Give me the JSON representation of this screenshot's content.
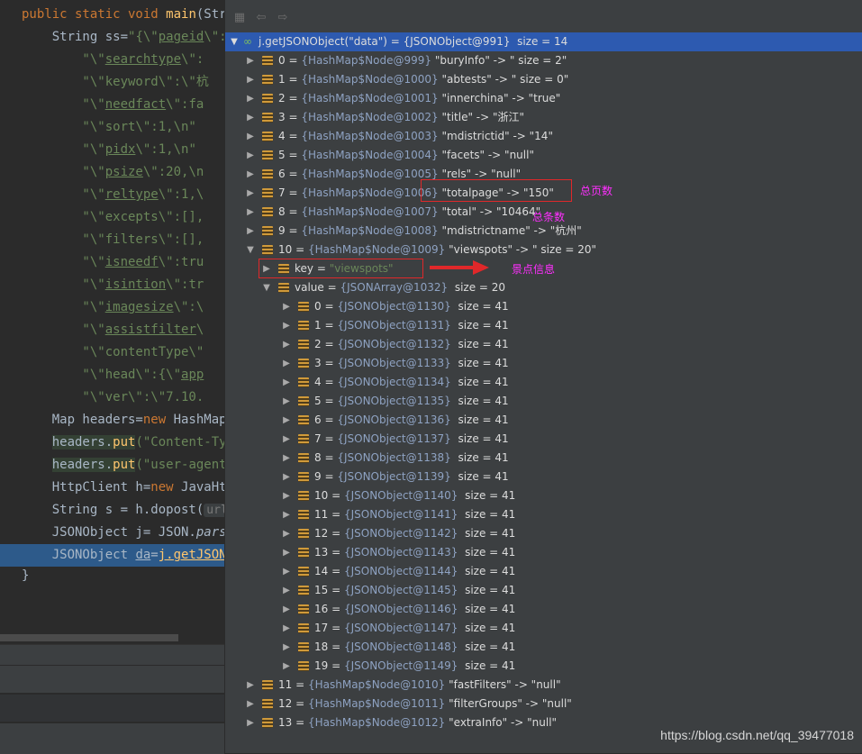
{
  "editor": {
    "lines": [
      {
        "segs": [
          [
            "kw",
            "public static void "
          ],
          [
            "fn",
            "main"
          ],
          [
            "p",
            "(Stri"
          ]
        ]
      },
      {
        "segs": [
          [
            "p",
            "    String ss="
          ],
          [
            "str",
            "\"{\\\""
          ],
          [
            "str ul",
            "pageid"
          ],
          [
            "str",
            "\\\":1"
          ]
        ]
      },
      {
        "segs": [
          [
            "str",
            "        \"\\\""
          ],
          [
            "str ul",
            "searchtype"
          ],
          [
            "str",
            "\\\":"
          ]
        ]
      },
      {
        "segs": [
          [
            "str",
            "        \"\\\"keyword\\\":\\\"杭"
          ]
        ]
      },
      {
        "segs": [
          [
            "str",
            "        \"\\\""
          ],
          [
            "str ul",
            "needfact"
          ],
          [
            "str",
            "\\\":fa"
          ]
        ]
      },
      {
        "segs": [
          [
            "str",
            "        \"\\\"sort\\\":1,\\n\""
          ]
        ]
      },
      {
        "segs": [
          [
            "str",
            "        \"\\\""
          ],
          [
            "str ul",
            "pidx"
          ],
          [
            "str",
            "\\\":1,\\n\""
          ]
        ]
      },
      {
        "segs": [
          [
            "str",
            "        \"\\\""
          ],
          [
            "str ul",
            "psize"
          ],
          [
            "str",
            "\\\":20,\\n"
          ]
        ]
      },
      {
        "segs": [
          [
            "str",
            "        \"\\\""
          ],
          [
            "str ul",
            "reltype"
          ],
          [
            "str",
            "\\\":1,\\"
          ]
        ]
      },
      {
        "segs": [
          [
            "str",
            "        \"\\\"excepts\\\":[],"
          ]
        ]
      },
      {
        "segs": [
          [
            "str",
            "        \"\\\"filters\\\":[],"
          ]
        ]
      },
      {
        "segs": [
          [
            "str",
            "        \"\\\""
          ],
          [
            "str ul",
            "isneedf"
          ],
          [
            "str",
            "\\\":tru"
          ]
        ]
      },
      {
        "segs": [
          [
            "str",
            "        \"\\\""
          ],
          [
            "str ul",
            "isintion"
          ],
          [
            "str",
            "\\\":tr"
          ]
        ]
      },
      {
        "segs": [
          [
            "str",
            "        \"\\\""
          ],
          [
            "str ul",
            "imagesize"
          ],
          [
            "str",
            "\\\":\\"
          ]
        ]
      },
      {
        "segs": [
          [
            "str",
            "        \"\\\""
          ],
          [
            "str ul",
            "assistfilter"
          ],
          [
            "str",
            "\\"
          ]
        ]
      },
      {
        "segs": [
          [
            "str",
            "        \"\\\"contentType\\\""
          ]
        ]
      },
      {
        "segs": [
          [
            "str",
            "        \"\\\"head\\\":{\\\""
          ],
          [
            "str ul",
            "app"
          ]
        ]
      },
      {
        "segs": [
          [
            "str",
            "        \"\\\"ver\\\":\\\"7.10."
          ]
        ]
      },
      {
        "segs": [
          [
            "p",
            "    Map headers="
          ],
          [
            "kw",
            "new "
          ],
          [
            "p",
            "HashMap("
          ]
        ]
      },
      {
        "segs": [
          [
            "p",
            "    "
          ],
          [
            "hl",
            "headers."
          ],
          [
            "hl fn",
            "put"
          ],
          [
            "str",
            "(\"Content-Typ"
          ]
        ]
      },
      {
        "segs": [
          [
            "p",
            "    "
          ],
          [
            "hl",
            "headers."
          ],
          [
            "hl fn",
            "put"
          ],
          [
            "str",
            "(\"user-agent\""
          ]
        ]
      },
      {
        "segs": [
          [
            "p",
            "    HttpClient h="
          ],
          [
            "kw",
            "new "
          ],
          [
            "p",
            "JavaHtt"
          ]
        ]
      },
      {
        "segs": [
          [
            "p",
            "    String s = h.dopost("
          ],
          [
            "hint",
            "url:"
          ]
        ]
      },
      {
        "segs": [
          [
            "p",
            "    JSONObject j= JSON."
          ],
          [
            "it",
            "parse"
          ]
        ]
      },
      {
        "segs": [
          [
            "p",
            "    JSONObject "
          ],
          [
            "ul",
            "da"
          ],
          [
            "p",
            "="
          ],
          [
            "fn ul",
            "j.getJSONO"
          ]
        ]
      },
      {
        "segs": [
          [
            "p",
            "}"
          ]
        ]
      }
    ]
  },
  "panel": {
    "root": {
      "text": "j.getJSONObject(\"data\") = {JSONObject@991}  size = 14"
    },
    "rows": [
      {
        "key": "0",
        "type": "{HashMap$Node@999}",
        "val": "\"buryInfo\" -> \" size = 2\""
      },
      {
        "key": "1",
        "type": "{HashMap$Node@1000}",
        "val": "\"abtests\" -> \" size = 0\""
      },
      {
        "key": "2",
        "type": "{HashMap$Node@1001}",
        "val": "\"innerchina\" -> \"true\""
      },
      {
        "key": "3",
        "type": "{HashMap$Node@1002}",
        "val": "\"title\" -> \"浙江\""
      },
      {
        "key": "4",
        "type": "{HashMap$Node@1003}",
        "val": "\"mdistrictid\" -> \"14\""
      },
      {
        "key": "5",
        "type": "{HashMap$Node@1004}",
        "val": "\"facets\" -> \"null\""
      },
      {
        "key": "6",
        "type": "{HashMap$Node@1005}",
        "val": "\"rels\" -> \"null\""
      },
      {
        "key": "7",
        "type": "{HashMap$Node@1006}",
        "val": "\"totalpage\" -> \"150\""
      },
      {
        "key": "8",
        "type": "{HashMap$Node@1007}",
        "val": "\"total\" -> \"10464\""
      },
      {
        "key": "9",
        "type": "{HashMap$Node@1008}",
        "val": "\"mdistrictname\" -> \"杭州\""
      },
      {
        "key": "10",
        "type": "{HashMap$Node@1009}",
        "val": "\"viewspots\" -> \" size = 20\""
      }
    ],
    "key_row": {
      "label": "key",
      "eq": " = ",
      "value": "\"viewspots\""
    },
    "value_row": {
      "label": "value",
      "type": "{JSONArray@1032}",
      "size": "size = 20"
    },
    "items": [
      {
        "key": "0",
        "type": "{JSONObject@1130}",
        "size": "size = 41"
      },
      {
        "key": "1",
        "type": "{JSONObject@1131}",
        "size": "size = 41"
      },
      {
        "key": "2",
        "type": "{JSONObject@1132}",
        "size": "size = 41"
      },
      {
        "key": "3",
        "type": "{JSONObject@1133}",
        "size": "size = 41"
      },
      {
        "key": "4",
        "type": "{JSONObject@1134}",
        "size": "size = 41"
      },
      {
        "key": "5",
        "type": "{JSONObject@1135}",
        "size": "size = 41"
      },
      {
        "key": "6",
        "type": "{JSONObject@1136}",
        "size": "size = 41"
      },
      {
        "key": "7",
        "type": "{JSONObject@1137}",
        "size": "size = 41"
      },
      {
        "key": "8",
        "type": "{JSONObject@1138}",
        "size": "size = 41"
      },
      {
        "key": "9",
        "type": "{JSONObject@1139}",
        "size": "size = 41"
      },
      {
        "key": "10",
        "type": "{JSONObject@1140}",
        "size": "size = 41"
      },
      {
        "key": "11",
        "type": "{JSONObject@1141}",
        "size": "size = 41"
      },
      {
        "key": "12",
        "type": "{JSONObject@1142}",
        "size": "size = 41"
      },
      {
        "key": "13",
        "type": "{JSONObject@1143}",
        "size": "size = 41"
      },
      {
        "key": "14",
        "type": "{JSONObject@1144}",
        "size": "size = 41"
      },
      {
        "key": "15",
        "type": "{JSONObject@1145}",
        "size": "size = 41"
      },
      {
        "key": "16",
        "type": "{JSONObject@1146}",
        "size": "size = 41"
      },
      {
        "key": "17",
        "type": "{JSONObject@1147}",
        "size": "size = 41"
      },
      {
        "key": "18",
        "type": "{JSONObject@1148}",
        "size": "size = 41"
      },
      {
        "key": "19",
        "type": "{JSONObject@1149}",
        "size": "size = 41"
      }
    ],
    "tail_rows": [
      {
        "key": "11",
        "type": "{HashMap$Node@1010}",
        "val": "\"fastFilters\" -> \"null\""
      },
      {
        "key": "12",
        "type": "{HashMap$Node@1011}",
        "val": "\"filterGroups\" -> \"null\""
      },
      {
        "key": "13",
        "type": "{HashMap$Node@1012}",
        "val": "\"extraInfo\" -> \"null\""
      }
    ]
  },
  "annotations": {
    "total_pages": "总页数",
    "total_count": "总条数",
    "spot_info": "景点信息"
  },
  "watermark": "https://blog.csdn.net/qq_39477018",
  "colors": {
    "selection": "#2d5ab0",
    "callout_red": "#e0282a",
    "note_magenta": "#ff2fff"
  }
}
